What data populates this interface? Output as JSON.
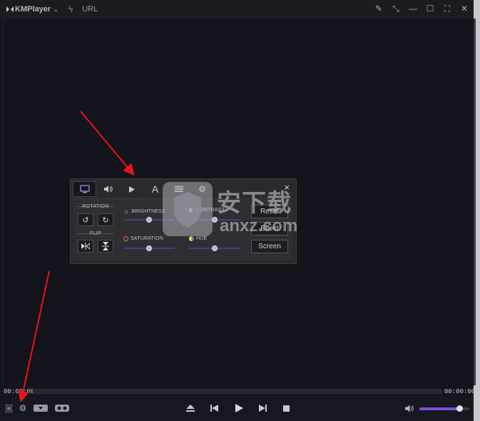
{
  "app": {
    "title": "KMPlayer",
    "url_label": "URL"
  },
  "panel": {
    "tabs": [
      "screen-tab",
      "audio-tab",
      "playback-tab",
      "subtitle-tab",
      "list-tab",
      "settings-tab"
    ],
    "tab_text_A": "A",
    "close_label": "×",
    "rotation_label": "ROTATION",
    "flip_label": "FLIP",
    "brightness_label": "BRIGHTNESS",
    "contrast_label": "CONTRAST",
    "saturation_label": "SATURATION",
    "hue_label": "HUE",
    "reset_label": "Reset",
    "effect_label": "Effect",
    "screen_label": "Screen",
    "levels": {
      "brightness": 0.5,
      "contrast": 0.5,
      "saturation": 0.5,
      "hue": 0.5
    }
  },
  "watermark": {
    "cn": "安下载",
    "url": "anxz.com"
  },
  "playback": {
    "time_current": "00:00:00",
    "time_total": "00:00:00",
    "progress": 0,
    "volume": 0.8
  },
  "colors": {
    "accent": "#7a4fd8",
    "arrow": "#e8141c"
  }
}
